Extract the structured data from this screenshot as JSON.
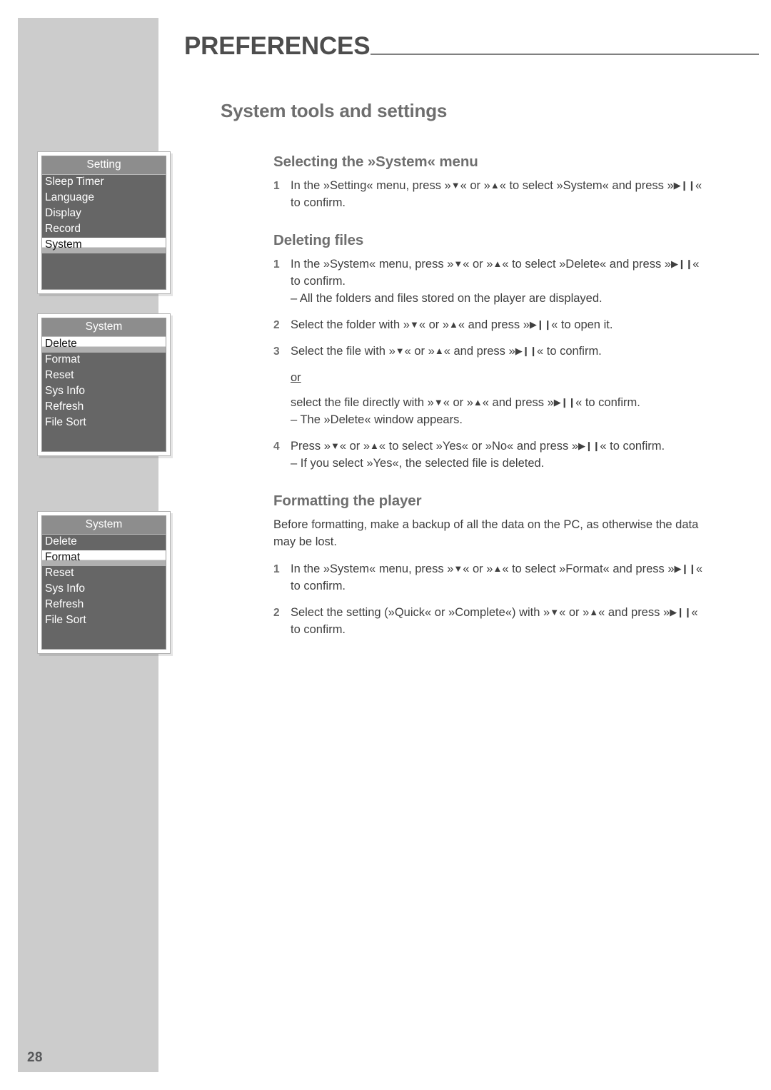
{
  "header": {
    "title": "PREFERENCES"
  },
  "page_title": "System tools and settings",
  "page_number": "28",
  "glyphs": {
    "down": "▼",
    "up": "▲",
    "play_pause": "▶❙❙"
  },
  "menus": [
    {
      "name": "setting-menu",
      "title": "Setting",
      "items": [
        "Sleep Timer",
        "Language",
        "Display",
        "Record",
        "System"
      ],
      "selected": "System"
    },
    {
      "name": "system-menu-delete",
      "title": "System",
      "items": [
        "Delete",
        "Format",
        "Reset",
        "Sys Info",
        "Refresh",
        "File Sort"
      ],
      "selected": "Delete"
    },
    {
      "name": "system-menu-format",
      "title": "System",
      "items": [
        "Delete",
        "Format",
        "Reset",
        "Sys Info",
        "Refresh",
        "File Sort"
      ],
      "selected": "Format"
    }
  ],
  "sections": {
    "selecting_system": {
      "heading": "Selecting the »System« menu",
      "step1_num": "1",
      "step1_a": "In the »Setting« menu, press »",
      "step1_b": "« or »",
      "step1_c": "« to select »System« and press »",
      "step1_d": "«",
      "step1_e": "to confirm."
    },
    "deleting_files": {
      "heading": "Deleting files",
      "step1_num": "1",
      "step1_a": "In the »System« menu, press »",
      "step1_b": "« or »",
      "step1_c": "« to select »Delete« and press »",
      "step1_d": "«",
      "step1_e": "to confirm.",
      "step1_sub": "– All the folders and files stored on the player are displayed.",
      "step2_num": "2",
      "step2_a": "Select the folder with »",
      "step2_b": "« or »",
      "step2_c": "« and press »",
      "step2_d": "« to open it.",
      "step3_num": "3",
      "step3_a": "Select the file with »",
      "step3_b": "« or »",
      "step3_c": "« and press »",
      "step3_d": "« to confirm.",
      "or_label": "or",
      "alt_a": "select the file directly with »",
      "alt_b": "« or »",
      "alt_c": "« and press »",
      "alt_d": "« to confirm.",
      "alt_sub": "– The »Delete« window appears.",
      "step4_num": "4",
      "step4_a": "Press »",
      "step4_b": "« or »",
      "step4_c": "« to select »Yes« or »No« and press »",
      "step4_d": "« to confirm.",
      "step4_sub": "– If you select »Yes«, the selected file is deleted."
    },
    "formatting_player": {
      "heading": "Formatting the player",
      "intro": "Before formatting, make a backup of all the data on the PC, as otherwise the data may be lost.",
      "step1_num": "1",
      "step1_a": "In the »System« menu, press »",
      "step1_b": "« or »",
      "step1_c": "« to select »Format« and press »",
      "step1_d": "«",
      "step1_e": "to confirm.",
      "step2_num": "2",
      "step2_a": "Select the setting (»Quick« or »Complete«) with »",
      "step2_b": "« or »",
      "step2_c": "« and press »",
      "step2_d": "«",
      "step2_e": "to confirm."
    }
  }
}
